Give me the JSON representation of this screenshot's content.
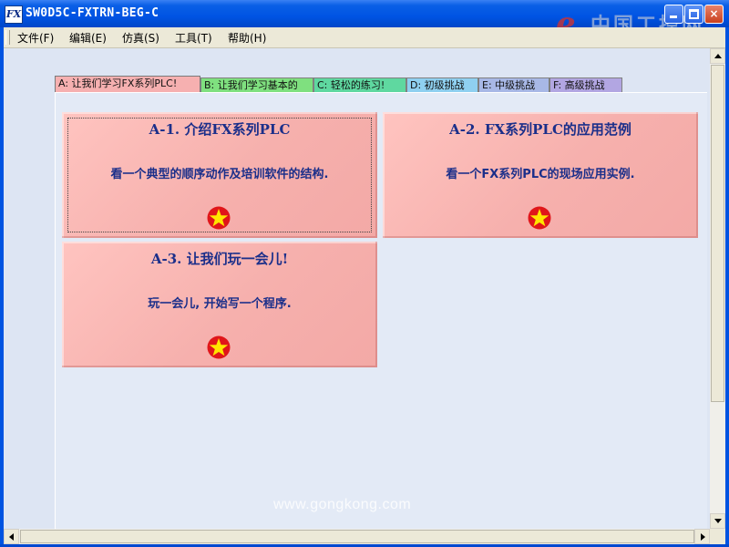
{
  "window": {
    "title": "SW0D5C-FXTRN-BEG-C",
    "app_icon": "FX",
    "minimize_icon": "minimize-icon",
    "maximize_icon": "maximize-icon",
    "close_icon": "×"
  },
  "watermark": {
    "logo_mark": "e",
    "logo_text": "中国工控网",
    "logo_url": "www.gongkong.com",
    "bottom_text": "www.gongkong.com"
  },
  "menu": {
    "items": [
      {
        "label": "文件(F)"
      },
      {
        "label": "编辑(E)"
      },
      {
        "label": "仿真(S)"
      },
      {
        "label": "工具(T)"
      },
      {
        "label": "帮助(H)"
      }
    ]
  },
  "tabs": [
    {
      "label": "A: 让我们学习FX系列PLC!",
      "color": "#f6b0b0",
      "active": true
    },
    {
      "label": "B: 让我们学习基本的",
      "color": "#7fe07f"
    },
    {
      "label": "C: 轻松的练习!",
      "color": "#5fd8a0"
    },
    {
      "label": "D: 初级挑战",
      "color": "#8fd0f0"
    },
    {
      "label": "E: 中级挑战",
      "color": "#a8b8e6"
    },
    {
      "label": "F: 高级挑战",
      "color": "#b2a6e2"
    }
  ],
  "cards": [
    {
      "title": "A-1. 介绍FX系列PLC",
      "description": "看一个典型的顺序动作及培训软件的结构.",
      "icon": "star-icon",
      "focused": true
    },
    {
      "title": "A-2. FX系列PLC的应用范例",
      "description": "看一个FX系列PLC的现场应用实例.",
      "icon": "star-icon"
    },
    {
      "title": "A-3. 让我们玩一会儿!",
      "description": "玩一会儿, 开始写一个程序.",
      "icon": "star-icon"
    }
  ],
  "colors": {
    "card_bg": "#f6b0ad",
    "card_text": "#1b2f8a",
    "star_circle": "#e0161a",
    "star_fill": "#ffe600"
  }
}
